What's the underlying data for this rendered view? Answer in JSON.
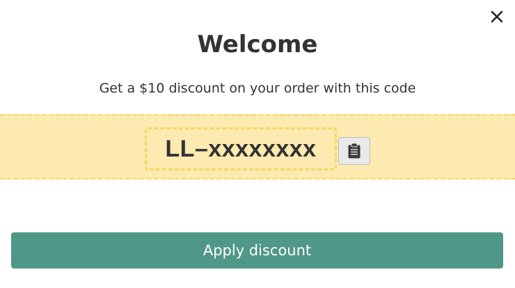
{
  "modal": {
    "close_icon": "close-icon",
    "title": "Welcome",
    "subtitle": "Get a $10 discount on your order with this code",
    "code": "LL–xxxxxxxx",
    "copy_icon": "clipboard-icon",
    "apply_label": "Apply discount"
  },
  "colors": {
    "band_background": "#fdeab0",
    "band_border": "#f6d565",
    "button_primary": "#4f9786",
    "text": "#333333"
  }
}
